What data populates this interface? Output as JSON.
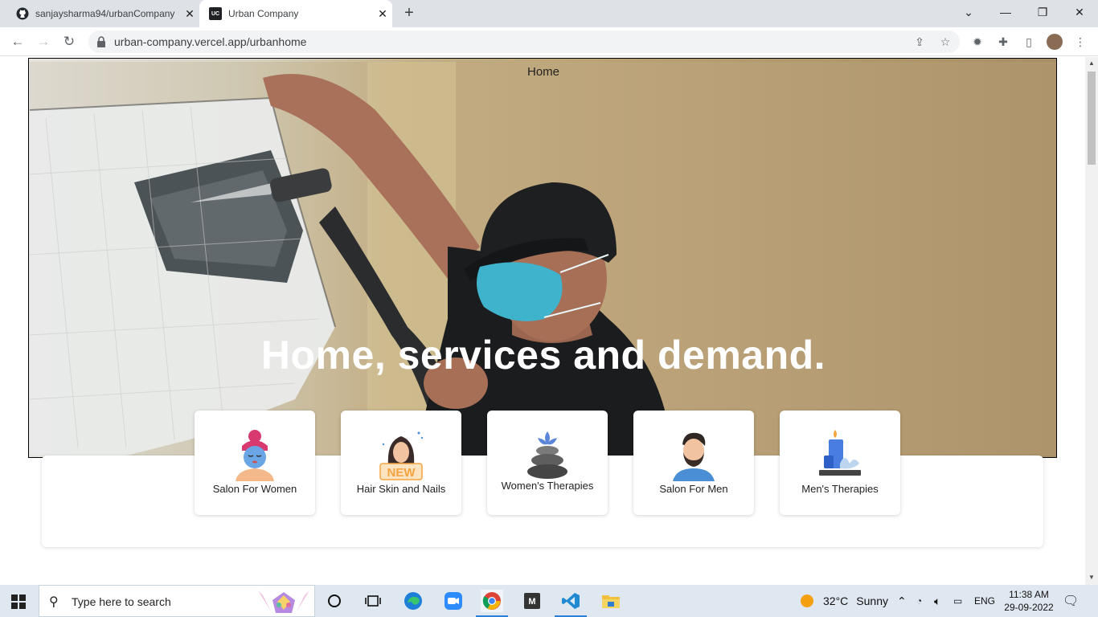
{
  "browser": {
    "tabs": [
      {
        "title": "sanjaysharma94/urbanCompany",
        "favicon": "github-icon"
      },
      {
        "title": "Urban Company",
        "favicon": "uc-icon",
        "favicon_text": "UC"
      }
    ],
    "url": "urban-company.vercel.app/urbanhome"
  },
  "page": {
    "nav_home": "Home",
    "headline": "Home, services and demand.",
    "categories": [
      {
        "label": "Salon For Women",
        "icon": "salon-women-icon"
      },
      {
        "label": "Hair Skin and Nails",
        "icon": "hair-skin-nails-icon",
        "badge": "NEW"
      },
      {
        "label": "Women's Therapies",
        "icon": "womens-therapies-icon"
      },
      {
        "label": "Salon For Men",
        "icon": "salon-men-icon"
      },
      {
        "label": "Men's Therapies",
        "icon": "mens-therapies-icon"
      }
    ]
  },
  "taskbar": {
    "search_placeholder": "Type here to search",
    "weather_temp": "32°C",
    "weather_text": "Sunny",
    "language": "ENG",
    "time": "11:38 AM",
    "date": "29-09-2022"
  },
  "colors": {
    "headline": "#ffffff",
    "tabstrip": "#dee1e6",
    "taskbar": "#dfe8f1",
    "accent_blue": "#2b7fd8",
    "mask": "#3fb3cc",
    "new_badge": "#f4a340"
  }
}
